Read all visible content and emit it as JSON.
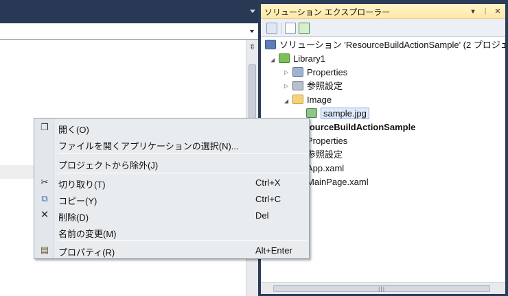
{
  "solution_explorer": {
    "title": "ソリューション エクスプローラー",
    "title_buttons": [
      "▾",
      "ᛁ",
      "✕"
    ],
    "toolbar_icons": [
      "properties-icon",
      "show-all-files-icon",
      "refresh-icon"
    ],
    "tree": {
      "solution_label": "ソリューション 'ResourceBuildActionSample' (2 プロジェ",
      "library_project": "Library1",
      "library_items": {
        "properties": "Properties",
        "references": "参照設定",
        "image_folder": "Image",
        "sample_file": "sample.jpg"
      },
      "main_project": "ResourceBuildActionSample",
      "main_items": {
        "properties": "Properties",
        "references": "参照設定",
        "app": "App.xaml",
        "mainpage": "MainPage.xaml"
      }
    },
    "hscroll_grip": "|||"
  },
  "editor": {
    "split_button": "⇳"
  },
  "context_menu": {
    "items": [
      {
        "label": "開く(O)",
        "shortcut": "",
        "icon": "open-icon"
      },
      {
        "label": "ファイルを開くアプリケーションの選択(N)...",
        "shortcut": "",
        "icon": ""
      },
      {
        "label": "プロジェクトから除外(J)",
        "shortcut": "",
        "icon": ""
      },
      {
        "label": "切り取り(T)",
        "shortcut": "Ctrl+X",
        "icon": "cut-icon"
      },
      {
        "label": "コピー(Y)",
        "shortcut": "Ctrl+C",
        "icon": "copy-icon"
      },
      {
        "label": "削除(D)",
        "shortcut": "Del",
        "icon": "delete-icon"
      },
      {
        "label": "名前の変更(M)",
        "shortcut": "",
        "icon": ""
      },
      {
        "label": "プロパティ(R)",
        "shortcut": "Alt+Enter",
        "icon": "properties-icon"
      }
    ]
  },
  "colors": {
    "chrome_background": "#2b3c59",
    "title_highlight": "#ffe8a6",
    "selection_border": "#84acdd"
  }
}
